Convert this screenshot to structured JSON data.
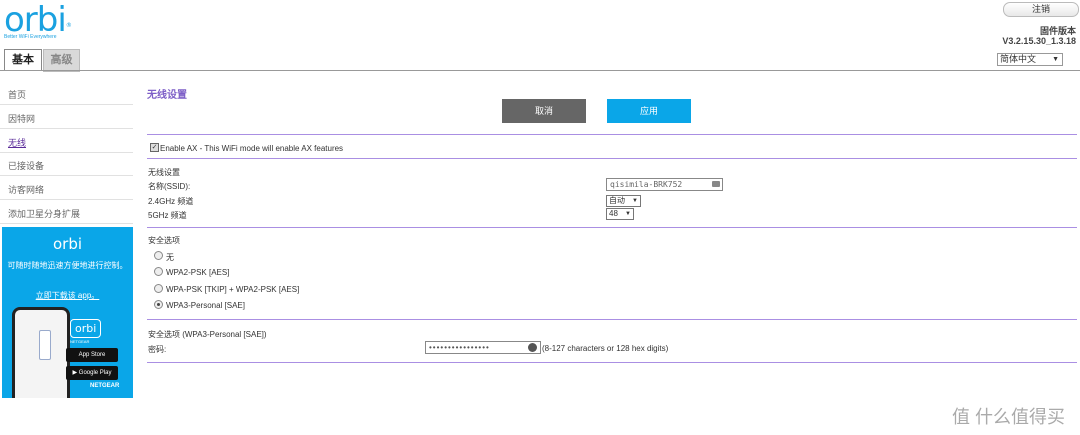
{
  "header": {
    "logo": "orbi",
    "logo_tm": "®",
    "tagline": "Better WiFi Everywhere",
    "logout": "注销",
    "firmware_label": "固件版本",
    "firmware_version": "V3.2.15.30_1.3.18",
    "language": "简体中文"
  },
  "tabs": [
    {
      "label": "基本"
    },
    {
      "label": "高级"
    }
  ],
  "sidebar": {
    "items": [
      {
        "label": "首页"
      },
      {
        "label": "因特网"
      },
      {
        "label": "无线"
      },
      {
        "label": "已接设备"
      },
      {
        "label": "访客网络"
      },
      {
        "label": "添加卫星分身扩展"
      }
    ]
  },
  "promo": {
    "logo": "orbi",
    "text": "可随时随地迅速方便地进行控制。",
    "link": "立即下载该 app。",
    "phone_logo": "orbi",
    "phone_sub": "NETGEAR",
    "app_store": "App Store",
    "google_play": "Google Play",
    "brand": "NETGEAR"
  },
  "content": {
    "title": "无线设置",
    "cancel": "取消",
    "apply": "应用",
    "enable_ax": "Enable AX - This WiFi mode will enable AX features",
    "wireless_section": "无线设置",
    "ssid_label": "名称(SSID):",
    "ssid_value": "qisimila-BRK752",
    "band24_label": "2.4GHz 频道",
    "band24_value": "自动",
    "band5_label": "5GHz 频道",
    "band5_value": "48",
    "security_title": "安全选项",
    "security_options": [
      {
        "label": "无",
        "selected": false
      },
      {
        "label": "WPA2-PSK [AES]",
        "selected": false
      },
      {
        "label": "WPA-PSK [TKIP] + WPA2-PSK [AES]",
        "selected": false
      },
      {
        "label": "WPA3-Personal [SAE]",
        "selected": true
      }
    ],
    "sec_detail_title": "安全选项 (WPA3-Personal [SAE])",
    "password_label": "密码:",
    "password_value": "••••••••••••••••",
    "password_hint": "(8-127 characters or 128 hex digits)"
  },
  "watermark": "值 什么值得买"
}
